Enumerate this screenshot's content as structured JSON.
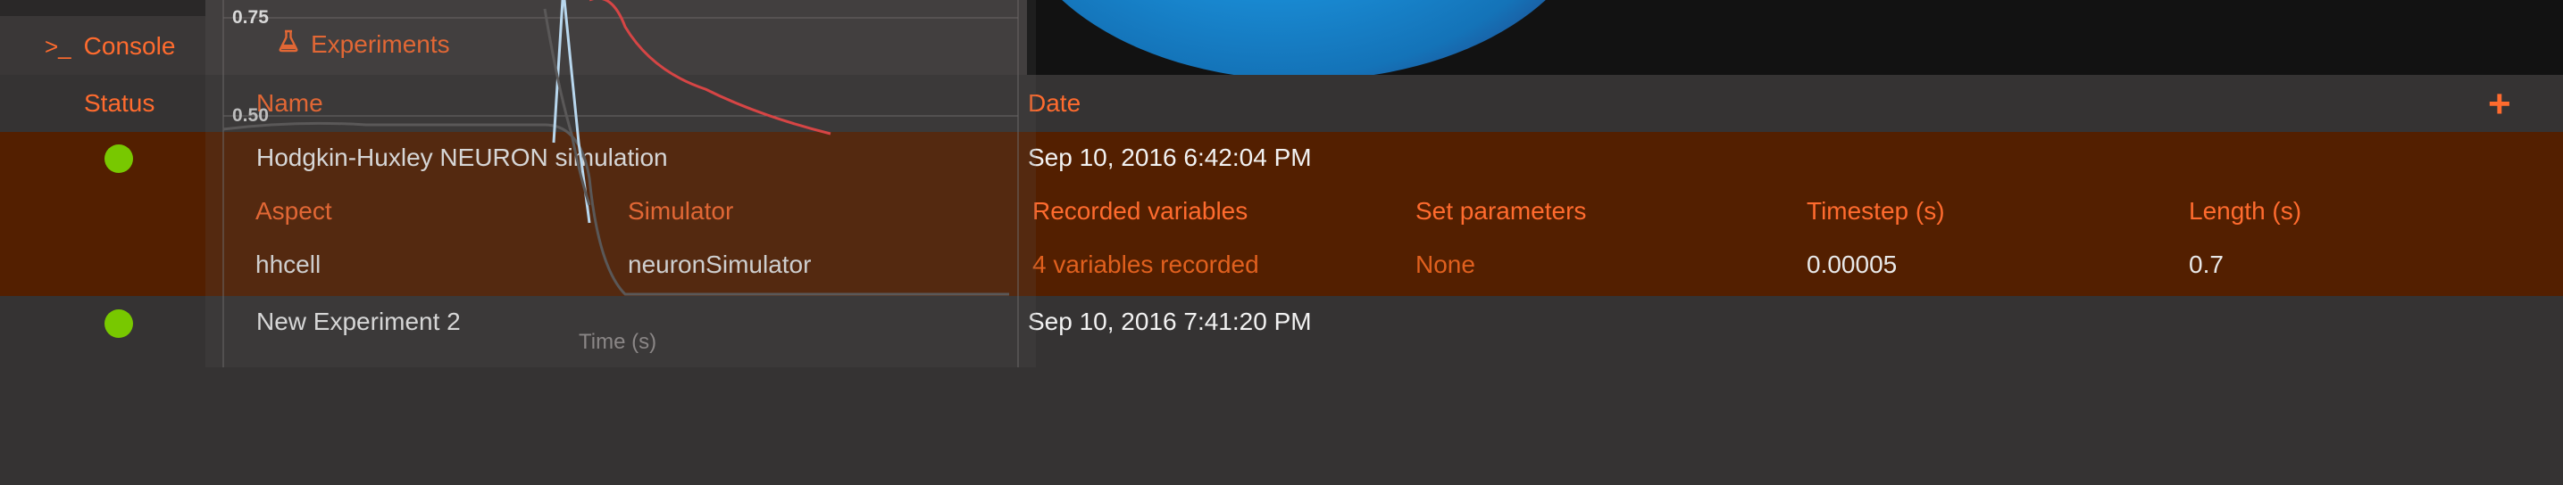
{
  "tabs": {
    "console_label": "Console",
    "console_icon": ">_",
    "experiments_label": "Experiments",
    "experiments_icon": "flask-icon"
  },
  "plot": {
    "tick_top": "0.75",
    "tick_mid": "0.50",
    "xlabel": "Time (s)"
  },
  "table": {
    "headers": {
      "status": "Status",
      "name": "Name",
      "date": "Date",
      "add": "+"
    },
    "rows": [
      {
        "status_color": "#78c800",
        "name": "Hodgkin-Huxley NEURON simulation",
        "date": "Sep 10, 2016 6:42:04 PM",
        "expanded": true,
        "details": {
          "headers": {
            "aspect": "Aspect",
            "simulator": "Simulator",
            "recorded": "Recorded variables",
            "parameters": "Set parameters",
            "timestep": "Timestep (s)",
            "length": "Length (s)"
          },
          "values": {
            "aspect": "hhcell",
            "simulator": "neuronSimulator",
            "recorded": "4 variables recorded",
            "parameters": "None",
            "timestep": "0.00005",
            "length": "0.7"
          }
        }
      },
      {
        "status_color": "#78c800",
        "name": "New Experiment 2",
        "date": "Sep 10, 2016 7:41:20 PM",
        "expanded": false
      }
    ]
  },
  "colors": {
    "accent": "#ff6b2e",
    "selected_row": "#531f00",
    "background": "#353333",
    "status_ok": "#78c800",
    "sphere": "#1a8fd8"
  }
}
